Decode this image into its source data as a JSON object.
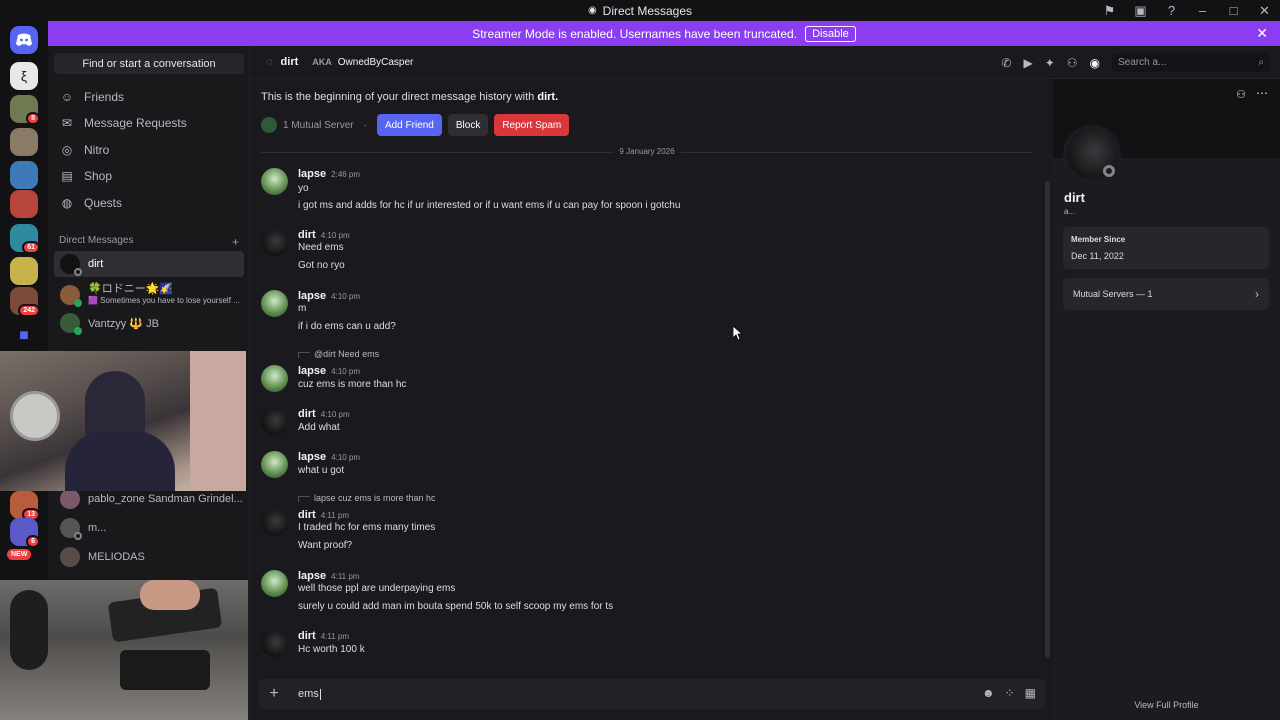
{
  "titlebar": {
    "title": "Direct Messages"
  },
  "banner": {
    "text": "Streamer Mode is enabled. Usernames have been truncated.",
    "disable_label": "Disable"
  },
  "servers": {
    "badges": [
      "8",
      "61",
      "242",
      "13",
      "6",
      "NEW"
    ]
  },
  "dm_panel": {
    "find_label": "Find or start a conversation",
    "nav": [
      {
        "label": "Friends",
        "icon": "friends-icon"
      },
      {
        "label": "Message Requests",
        "icon": "mail-icon"
      },
      {
        "label": "Nitro",
        "icon": "nitro-icon"
      },
      {
        "label": "Shop",
        "icon": "shop-icon"
      },
      {
        "label": "Quests",
        "icon": "quests-icon"
      }
    ],
    "dm_header": "Direct Messages",
    "dms": [
      {
        "name": "dirt",
        "sub": ""
      },
      {
        "name": "🍀ロドニー🌟🌠",
        "sub": "🟪 Sometimes you have to lose yourself ..."
      },
      {
        "name": "Vantzyy 🔱 JB",
        "sub": ""
      },
      {
        "name": "pablo_zone Sandman Grindel...",
        "sub": ""
      },
      {
        "name": "m...",
        "sub": ""
      },
      {
        "name": "MELIODAS",
        "sub": ""
      }
    ]
  },
  "chat_header": {
    "name": "dirt",
    "aka_label": "AKA",
    "aka_value": "OwnedByCasper",
    "search_placeholder": "Search a..."
  },
  "intro": {
    "text": "This is the beginning of your direct message history with",
    "name": "dirt.",
    "mutual": "1 Mutual Server",
    "add_friend": "Add Friend",
    "block": "Block",
    "report": "Report Spam"
  },
  "date_divider": "9 January 2026",
  "messages": [
    {
      "author": "lapse",
      "time": "2:46 pm",
      "lines": [
        "yo",
        "i got ms and adds for hc if ur interested or if u want ems if u can pay for spoon i gotchu"
      ]
    },
    {
      "author": "dirt",
      "time": "4:10 pm",
      "lines": [
        "Need ems",
        "Got no ryo"
      ]
    },
    {
      "author": "lapse",
      "time": "4:10 pm",
      "lines": [
        "m",
        "if i do ems can u add?"
      ]
    },
    {
      "author": "lapse",
      "time": "4:10 pm",
      "reply": "@dirt Need ems",
      "lines": [
        "cuz ems is more than hc"
      ]
    },
    {
      "author": "dirt",
      "time": "4:10 pm",
      "lines": [
        "Add what"
      ]
    },
    {
      "author": "lapse",
      "time": "4:10 pm",
      "lines": [
        "what u got"
      ]
    },
    {
      "author": "dirt",
      "time": "4:11 pm",
      "reply": "lapse cuz ems is more than hc",
      "lines": [
        "I traded hc for ems many times",
        "Want proof?"
      ]
    },
    {
      "author": "lapse",
      "time": "4:11 pm",
      "lines": [
        "well those ppl are underpaying ems",
        "surely u could add man im bouta spend 50k to self scoop my ems for ts"
      ]
    },
    {
      "author": "dirt",
      "time": "4:11 pm",
      "lines": [
        "Hc worth 100 k"
      ]
    }
  ],
  "composer": {
    "value": "ems"
  },
  "profile": {
    "name": "dirt",
    "sub": "a...",
    "member_since_label": "Member Since",
    "member_since": "Dec 11, 2022",
    "mutual_servers": "Mutual Servers — 1",
    "view_full": "View Full Profile"
  },
  "colors": {
    "accent": "#5865f2",
    "banner": "#8b3ef0",
    "danger": "#da373c",
    "online": "#23a55a"
  }
}
